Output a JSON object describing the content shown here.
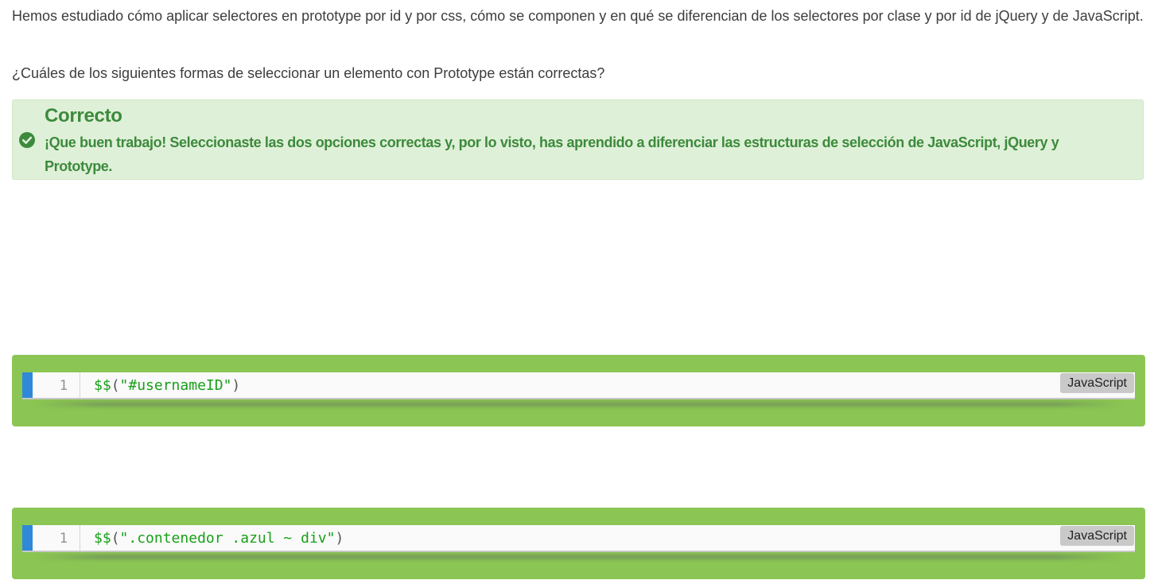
{
  "intro": {
    "text": "Hemos estudiado cómo aplicar selectores en prototype por id y por css, cómo se componen y en qué se diferencian de los selectores por clase y por id de jQuery y de JavaScript."
  },
  "question": {
    "text": "¿Cuáles de los siguientes formas de seleccionar un elemento con Prototype están correctas?"
  },
  "feedback": {
    "icon": "check-circle-icon",
    "title": "Correcto",
    "message": "¡Que buen trabajo! Seleccionaste las dos opciones correctas y, por lo visto, has aprendido a diferenciar las estructuras de selección de JavaScript, jQuery y Prototype.",
    "color": "#3c8a3c",
    "background": "#dff0d8"
  },
  "options": [
    {
      "line_number": "1",
      "code_fn": "$$",
      "code_open": "(",
      "code_string": "\"#usernameID\"",
      "code_close": ")",
      "language": "JavaScript",
      "selected": true
    },
    {
      "line_number": "1",
      "code_fn": "$$",
      "code_open": "(",
      "code_string": "\".contenedor .azul ~ div\"",
      "code_close": ")",
      "language": "JavaScript",
      "selected": true
    }
  ],
  "colors": {
    "selected_option": "#8bc553",
    "code_accent": "#2f89d8"
  }
}
